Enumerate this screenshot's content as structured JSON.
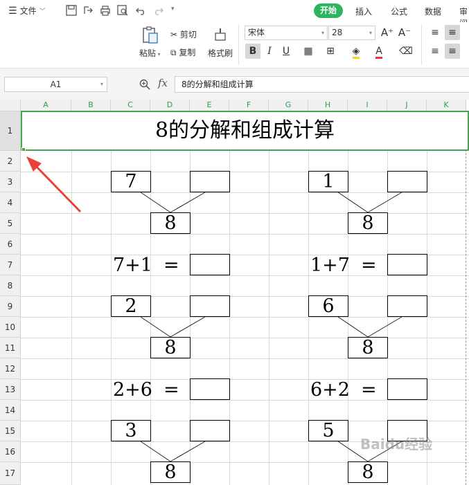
{
  "menubar": {
    "file_label": "文件",
    "tabs": [
      "开始",
      "插入",
      "公式",
      "数据",
      "审阅"
    ],
    "active_tab": "开始"
  },
  "ribbon": {
    "paste_label": "粘贴",
    "cut_label": "剪切",
    "copy_label": "复制",
    "format_painter_label": "格式刷",
    "font_name": "宋体",
    "font_size": "28",
    "bold_label": "B",
    "italic_label": "I",
    "underline_label": "U",
    "grow_font_label": "A⁺",
    "shrink_font_label": "A⁻",
    "font_color_label": "A"
  },
  "formula_bar": {
    "name_box": "A1",
    "fx_label": "fx",
    "formula": "8的分解和组成计算"
  },
  "sheet": {
    "columns": [
      "A",
      "B",
      "C",
      "D",
      "E",
      "F",
      "G",
      "H",
      "I",
      "J",
      "K"
    ],
    "rows": [
      "1",
      "2",
      "3",
      "4",
      "5",
      "6",
      "7",
      "8",
      "9",
      "10",
      "11",
      "12",
      "13",
      "14",
      "15",
      "16",
      "17"
    ],
    "title": "8的分解和组成计算",
    "left": {
      "g1": {
        "top": "7",
        "bottom": "8",
        "eq": "7+1",
        "eqsign": "="
      },
      "g2": {
        "top": "2",
        "bottom": "8",
        "eq": "2+6",
        "eqsign": "="
      },
      "g3": {
        "top": "3",
        "bottom": "8"
      }
    },
    "right": {
      "g1": {
        "top": "1",
        "bottom": "8",
        "eq": "1+7",
        "eqsign": "="
      },
      "g2": {
        "top": "6",
        "bottom": "8",
        "eq": "6+2",
        "eqsign": "="
      },
      "g3": {
        "top": "5",
        "bottom": "8"
      }
    }
  },
  "colors": {
    "accent": "#2db45f",
    "selection": "#4aa44f",
    "arrow": "#e8423a"
  },
  "watermark": "Baidu经验"
}
